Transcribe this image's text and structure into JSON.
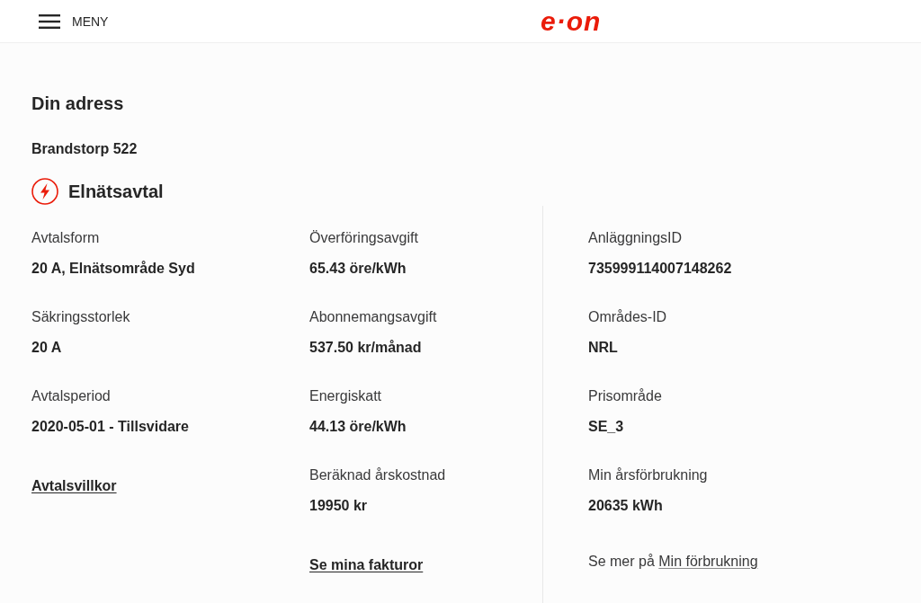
{
  "header": {
    "menu_label": "MENY",
    "logo": "e·on"
  },
  "address": {
    "heading": "Din adress",
    "street": "Brandstorp 522"
  },
  "agreement": {
    "title": "Elnätsavtal",
    "columns": [
      {
        "fields": [
          {
            "label": "Avtalsform",
            "value": "20 A, Elnätsområde Syd"
          },
          {
            "label": "Säkringsstorlek",
            "value": "20 A"
          },
          {
            "label": "Avtalsperiod",
            "value": "2020-05-01 - Tillsvidare"
          }
        ],
        "link": {
          "kind": "standalone",
          "label": "Avtalsvillkor"
        }
      },
      {
        "fields": [
          {
            "label": "Överföringsavgift",
            "value": "65.43 öre/kWh"
          },
          {
            "label": "Abonnemangsavgift",
            "value": "537.50 kr/månad"
          },
          {
            "label": "Energiskatt",
            "value": "44.13 öre/kWh"
          },
          {
            "label": "Beräknad årskostnad",
            "value": "19950 kr"
          }
        ],
        "link": {
          "kind": "standalone",
          "label": "Se mina fakturor"
        }
      },
      {
        "fields": [
          {
            "label": "AnläggningsID",
            "value": "735999114007148262"
          },
          {
            "label": "Områdes-ID",
            "value": "NRL"
          },
          {
            "label": "Prisområde",
            "value": "SE_3"
          },
          {
            "label": "Min årsförbrukning",
            "value": "20635 kWh"
          }
        ],
        "link": {
          "kind": "inline",
          "prefix": "Se mer på",
          "label": "Min förbrukning"
        }
      }
    ]
  }
}
